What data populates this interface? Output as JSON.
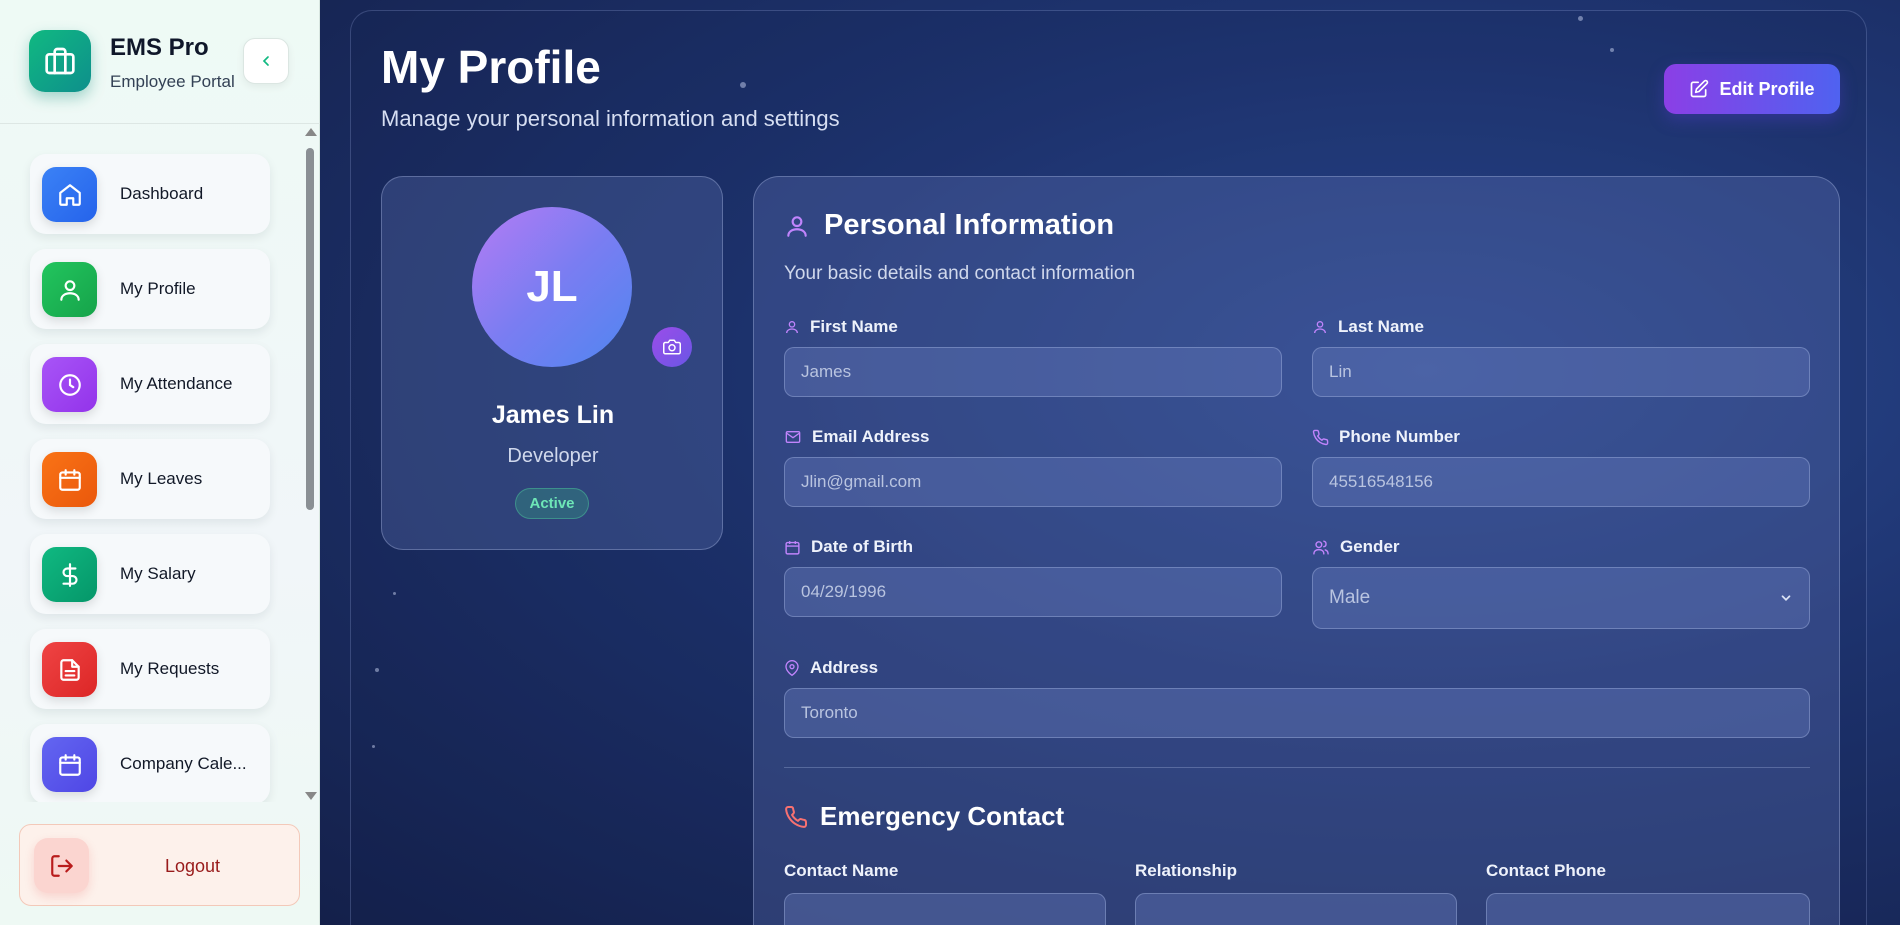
{
  "brand": {
    "title": "EMS Pro",
    "subtitle": "Employee Portal"
  },
  "sidebar": {
    "items": [
      {
        "label": "Dashboard",
        "icon": "home-icon",
        "color": "#3b82f6"
      },
      {
        "label": "My Profile",
        "icon": "user-icon",
        "color": "#22c55e"
      },
      {
        "label": "My Attendance",
        "icon": "clock-icon",
        "color": "#a855f7"
      },
      {
        "label": "My Leaves",
        "icon": "calendar-icon",
        "color": "#f97316"
      },
      {
        "label": "My Salary",
        "icon": "dollar-icon",
        "color": "#10b981"
      },
      {
        "label": "My Requests",
        "icon": "document-icon",
        "color": "#ef4444"
      },
      {
        "label": "Company Cale...",
        "icon": "calendar-icon",
        "color": "#6366f1"
      }
    ],
    "logout_label": "Logout"
  },
  "header": {
    "title": "My Profile",
    "subtitle": "Manage your personal information and settings",
    "edit_button": "Edit Profile"
  },
  "profile": {
    "initials": "JL",
    "name": "James Lin",
    "role": "Developer",
    "status": "Active"
  },
  "personal": {
    "title": "Personal Information",
    "subtitle": "Your basic details and contact information",
    "first_name_label": "First Name",
    "first_name_value": "James",
    "last_name_label": "Last Name",
    "last_name_value": "Lin",
    "email_label": "Email Address",
    "email_value": "Jlin@gmail.com",
    "phone_label": "Phone Number",
    "phone_value": "45516548156",
    "dob_label": "Date of Birth",
    "dob_value": "04/29/1996",
    "gender_label": "Gender",
    "gender_value": "Male",
    "address_label": "Address",
    "address_value": "Toronto"
  },
  "emergency": {
    "title": "Emergency Contact",
    "contact_name_label": "Contact Name",
    "relationship_label": "Relationship",
    "contact_phone_label": "Contact Phone"
  },
  "colors": {
    "accent": "#8b5cf6",
    "brand": "#10b981",
    "active": "#6ee7b7",
    "danger": "#ef4444"
  }
}
